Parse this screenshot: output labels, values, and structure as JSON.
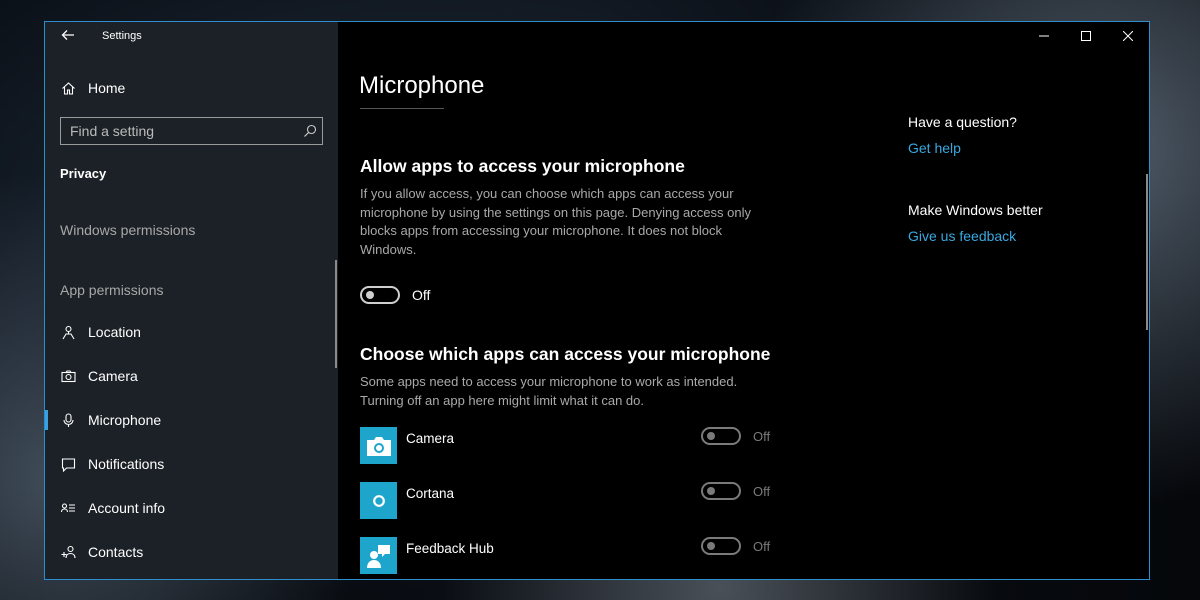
{
  "window": {
    "title": "Settings"
  },
  "sidebar": {
    "home_label": "Home",
    "search_placeholder": "Find a setting",
    "section_title": "Privacy",
    "windows_permissions_label": "Windows permissions",
    "app_permissions_label": "App permissions",
    "items": [
      {
        "label": "Location",
        "icon": "location-icon"
      },
      {
        "label": "Camera",
        "icon": "camera-icon"
      },
      {
        "label": "Microphone",
        "icon": "microphone-icon",
        "selected": true
      },
      {
        "label": "Notifications",
        "icon": "notifications-icon"
      },
      {
        "label": "Account info",
        "icon": "account-info-icon"
      },
      {
        "label": "Contacts",
        "icon": "contacts-icon"
      }
    ]
  },
  "main": {
    "page_title": "Microphone",
    "allow_heading": "Allow apps to access your microphone",
    "allow_description": "If you allow access, you can choose which apps can access your microphone by using the settings on this page. Denying access only blocks apps from accessing your microphone. It does not block Windows.",
    "allow_toggle_state": "Off",
    "choose_heading": "Choose which apps can access your microphone",
    "choose_description": "Some apps need to access your microphone to work as intended. Turning off an app here might limit what it can do.",
    "apps": [
      {
        "name": "Camera",
        "state": "Off",
        "icon": "camera-app-icon"
      },
      {
        "name": "Cortana",
        "state": "Off",
        "icon": "cortana-app-icon"
      },
      {
        "name": "Feedback Hub",
        "state": "Off",
        "icon": "feedback-hub-app-icon"
      }
    ]
  },
  "aside": {
    "question_heading": "Have a question?",
    "get_help_link": "Get help",
    "better_heading": "Make Windows better",
    "feedback_link": "Give us feedback"
  },
  "colors": {
    "accent": "#1ea5cb",
    "link": "#3aa8e0",
    "border": "#2d8fd0"
  }
}
